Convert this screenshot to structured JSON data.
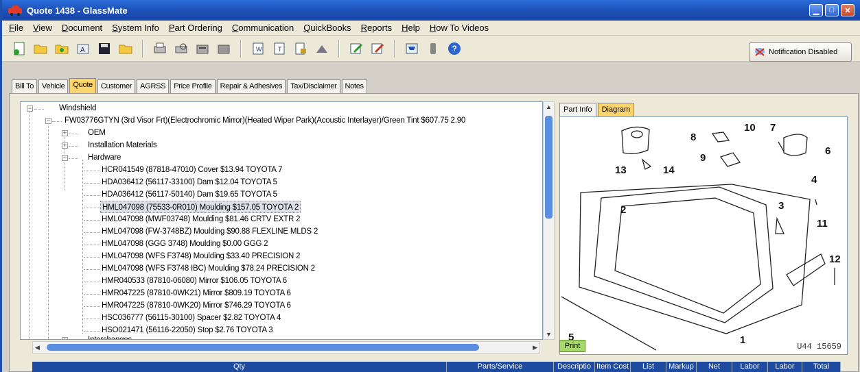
{
  "window": {
    "title": "Quote 1438 - GlassMate"
  },
  "menu": [
    "File",
    "View",
    "Document",
    "System Info",
    "Part Ordering",
    "Communication",
    "QuickBooks",
    "Reports",
    "Help",
    "How To Videos"
  ],
  "notification": {
    "label": "Notification Disabled"
  },
  "tabs": [
    "Bill To",
    "Vehicle",
    "Quote",
    "Customer",
    "AGRSS",
    "Price Profile",
    "Repair & Adhesives",
    "Tax/Disclaimer",
    "Notes"
  ],
  "active_tab": "Quote",
  "tree": {
    "root": "Windshield",
    "part": "FW03776GTYN    (3rd Visor Frt)(Electrochromic Mirror)(Heated Wiper Park)(Acoustic Interlayer)/Green Tint   $607.75   2.90",
    "groups": [
      "OEM",
      "Installation Materials",
      "Hardware"
    ],
    "hardware_items": [
      "HCR041549  (87818-47010)  Cover  $13.94  TOYOTA  7",
      "HDA036412  (56117-33100)  Dam  $12.04  TOYOTA  5",
      "HDA036412  (56117-50140)  Dam  $19.65  TOYOTA  5",
      "HML047098  (75533-0R010)  Moulding  $157.05  TOYOTA  2",
      "HML047098  (MWF03748)  Moulding  $81.46  CRTV EXTR  2",
      "HML047098  (FW-3748BZ)  Moulding  $90.88  FLEXLINE MLDS  2",
      "HML047098  (GGG 3748)  Moulding  $0.00  GGG  2",
      "HML047098  (WFS F3748)  Moulding  $33.40  PRECISION  2",
      "HML047098  (WFS F3748 IBC)  Moulding  $78.24  PRECISION  2",
      "HMR040533  (87810-06080)  Mirror  $106.05  TOYOTA  6",
      "HMR047225  (87810-0WK21)  Mirror  $809.19  TOYOTA  6",
      "HMR047225  (87810-0WK20)  Mirror  $746.29  TOYOTA  6",
      "HSC036777  (56115-30100)  Spacer  $2.82  TOYOTA  4",
      "HSO021471  (56116-22050)  Stop  $2.76  TOYOTA  3"
    ],
    "selected_index": 3,
    "interchanges": "Interchanges"
  },
  "right_tabs": [
    "Part Info",
    "Diagram"
  ],
  "active_right_tab": "Diagram",
  "diagram": {
    "callouts": [
      "1",
      "2",
      "3",
      "4",
      "5",
      "6",
      "7",
      "8",
      "9",
      "10",
      "11",
      "12",
      "13",
      "14"
    ],
    "ref": "U44  15659"
  },
  "print_label": "Print",
  "grid_columns": [
    "Qty",
    "Parts/Service",
    "Descriptio",
    "Item Cost",
    "List",
    "Markup",
    "Net",
    "Labor",
    "Labor",
    "Total"
  ]
}
